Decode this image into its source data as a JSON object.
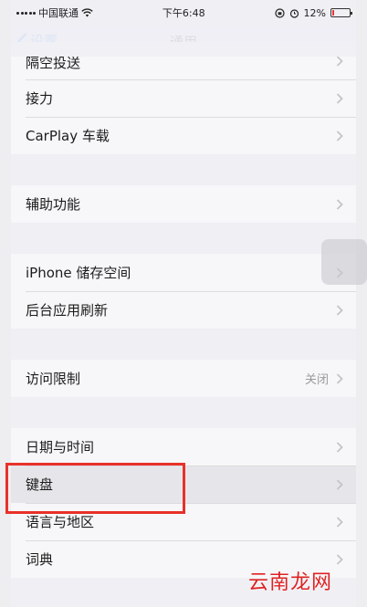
{
  "status": {
    "carrier": "中国联通",
    "time": "下午6:48",
    "battery": "12%",
    "battery_level": 0.12
  },
  "nav": {
    "back_label": "设置",
    "title": "通用"
  },
  "groups": [
    {
      "rows": [
        {
          "label": "隔空投送"
        },
        {
          "label": "接力"
        },
        {
          "label": "CarPlay 车载"
        }
      ]
    },
    {
      "rows": [
        {
          "label": "辅助功能"
        }
      ]
    },
    {
      "rows": [
        {
          "label": "iPhone 储存空间"
        },
        {
          "label": "后台应用刷新"
        }
      ]
    },
    {
      "rows": [
        {
          "label": "访问限制",
          "value": "关闭"
        }
      ]
    },
    {
      "rows": [
        {
          "label": "日期与时间"
        },
        {
          "label": "键盘"
        },
        {
          "label": "语言与地区"
        },
        {
          "label": "词典"
        }
      ]
    }
  ],
  "watermark": "云南龙网",
  "colors": {
    "accent": "#1a7cf5",
    "highlight": "#e8312a"
  }
}
